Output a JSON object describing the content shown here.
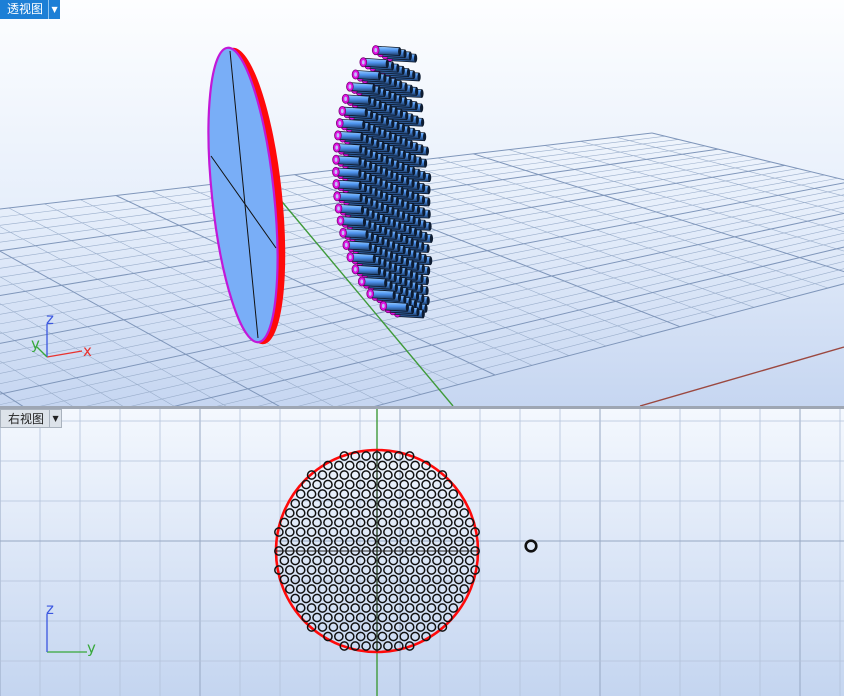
{
  "viewports": {
    "perspective": {
      "title": "透视图",
      "axis_labels": {
        "x": "x",
        "y": "y",
        "z": "z"
      }
    },
    "right": {
      "title": "右视图",
      "axis_labels": {
        "y": "y",
        "z": "z"
      }
    }
  },
  "dropdown_icon": "triangle-down-icon",
  "colors": {
    "grid_background": "#cfdff5",
    "active_tab": "#1c7fd6",
    "axis_x": "#e8332f",
    "axis_y": "#37a83a",
    "axis_z": "#3a56e0",
    "aperture_ring": "#ff0000",
    "tube_face": "#e011e0",
    "disk_fill": "#79aef7"
  }
}
